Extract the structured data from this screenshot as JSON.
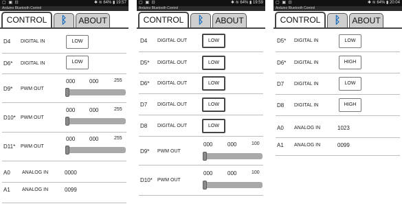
{
  "screens": [
    {
      "status": {
        "left_icons": "▢ ▣ ⊡",
        "right": "✱ ≋ 64% ▮ 19:57"
      },
      "title": "Arduino Bluetooth Control",
      "tabs": {
        "control": "CONTROL",
        "bluetooth_icon": "bluetooth-icon",
        "about": "ABOUT"
      },
      "digital": [
        {
          "pin": "D4",
          "func": "DIGITAL IN",
          "state": "LOW"
        },
        {
          "pin": "D6*",
          "func": "DIGITAL IN",
          "state": "LOW"
        }
      ],
      "pwm_max_label": "255",
      "pwm": [
        {
          "pin": "D9*",
          "func": "PWM OUT",
          "min_label": "000",
          "current": "000",
          "max": "255",
          "level": 0
        },
        {
          "pin": "D10*",
          "func": "PWM OUT",
          "min_label": "000",
          "current": "000",
          "max": "255",
          "level": 0
        },
        {
          "pin": "D11*",
          "func": "PWM OUT",
          "min_label": "000",
          "current": "000",
          "max": "255",
          "level": 0
        }
      ],
      "analog": [
        {
          "pin": "A0",
          "func": "ANALOG IN",
          "value": "0000"
        },
        {
          "pin": "A1",
          "func": "ANALOG IN",
          "value": "0099"
        }
      ]
    },
    {
      "status": {
        "left_icons": "▢ ▣ ⊡",
        "right": "✱ ≋ 64% ▮ 19:59"
      },
      "title": "Arduino Bluetooth Control",
      "tabs": {
        "control": "CONTROL",
        "bluetooth_icon": "bluetooth-icon",
        "about": "ABOUT"
      },
      "digital": [
        {
          "pin": "D4",
          "func": "DIGITAL OUT",
          "state": "LOW"
        },
        {
          "pin": "D5*",
          "func": "DIGITAL OUT",
          "state": "LOW"
        },
        {
          "pin": "D6*",
          "func": "DIGITAL OUT",
          "state": "LOW"
        },
        {
          "pin": "D7",
          "func": "DIGITAL OUT",
          "state": "LOW"
        },
        {
          "pin": "D8",
          "func": "DIGITAL OUT",
          "state": "LOW"
        }
      ],
      "pwm": [
        {
          "pin": "D9*",
          "func": "PWM OUT",
          "min_label": "000",
          "current": "000",
          "max": "100",
          "level": 0
        },
        {
          "pin": "D10*",
          "func": "PWM OUT",
          "min_label": "000",
          "current": "000",
          "max": "100",
          "level": 0
        }
      ]
    },
    {
      "status": {
        "left_icons": "▢ ▣ ⊡",
        "right": "✱ ≋ 64% ▮ 20:04"
      },
      "title": "Arduino Bluetooth Control",
      "tabs": {
        "control": "CONTROL",
        "bluetooth_icon": "bluetooth-icon",
        "about": "ABOUT"
      },
      "digital": [
        {
          "pin": "D5*",
          "func": "DIGITAL IN",
          "state": "LOW"
        },
        {
          "pin": "D6*",
          "func": "DIGITAL IN",
          "state": "HIGH"
        },
        {
          "pin": "D7",
          "func": "DIGITAL IN",
          "state": "LOW"
        },
        {
          "pin": "D8",
          "func": "DIGITAL IN",
          "state": "HIGH"
        }
      ],
      "analog": [
        {
          "pin": "A0",
          "func": "ANALOG IN",
          "value": "1023"
        },
        {
          "pin": "A1",
          "func": "ANALOG IN",
          "value": "0099"
        }
      ]
    }
  ],
  "colors": {
    "bluetooth": "#1f6fc0",
    "slider_track": "#a9a9a9",
    "slider_thumb": "#8a8a8a"
  }
}
